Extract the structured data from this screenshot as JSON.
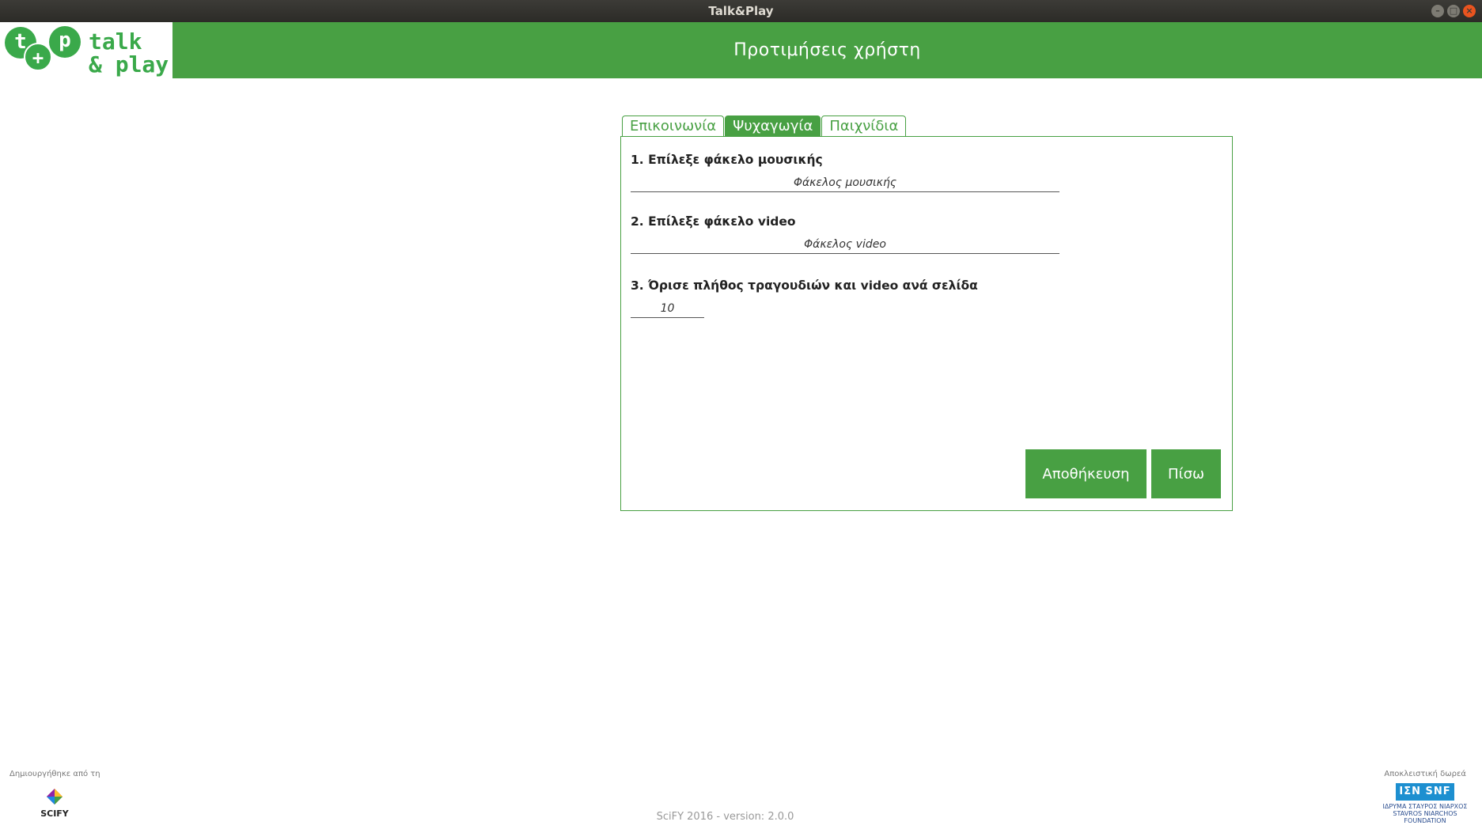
{
  "window": {
    "title": "Talk&Play",
    "controls": [
      "minimize",
      "maximize",
      "close"
    ]
  },
  "header": {
    "logo": {
      "circles": [
        "t",
        "+",
        "p"
      ],
      "text_line1": "talk",
      "text_line2": "& play"
    },
    "page_title": "Προτιμήσεις χρήστη"
  },
  "tabs": [
    {
      "label": "Επικοινωνία",
      "active": false
    },
    {
      "label": "Ψυχαγωγία",
      "active": true
    },
    {
      "label": "Παιχνίδια",
      "active": false
    }
  ],
  "form": {
    "music_folder": {
      "label": "1. Επίλεξε φάκελο μουσικής",
      "placeholder": "Φάκελος μουσικής",
      "value": ""
    },
    "video_folder": {
      "label": "2. Επίλεξε φάκελο video",
      "placeholder": "Φάκελος video",
      "value": ""
    },
    "items_per_page": {
      "label": "3. Όρισε πλήθος τραγουδιών και video ανά σελίδα",
      "value": "10"
    }
  },
  "buttons": {
    "save": "Αποθήκευση",
    "back": "Πίσω"
  },
  "footer": {
    "created_by": "Δημιουργήθηκε από τη",
    "scify_logo_text": "SCIFY",
    "version": "SciFY 2016 - version: 2.0.0",
    "donation": "Αποκλειστική δωρεά",
    "snf_mark": "ΙΣΝ SNF",
    "snf_line1": "ΙΔΡΥΜΑ ΣΤΑΥΡΟΣ ΝΙΑΡΧΟΣ",
    "snf_line2": "STAVROS NIARCHOS",
    "snf_line3": "FOUNDATION"
  },
  "colors": {
    "brand_green": "#48a043",
    "logo_green": "#3aa94a",
    "snf_blue": "#1d8fd0"
  }
}
